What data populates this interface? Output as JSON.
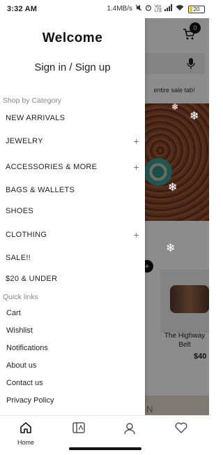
{
  "status_bar": {
    "time": "3:32 AM",
    "speed": "1.4MB/s",
    "net_label": "Vo) LTE",
    "battery": "20",
    "icons": [
      "mute-icon",
      "alarm-icon",
      "signal-icon",
      "wifi-icon",
      "battery-icon"
    ]
  },
  "background": {
    "cart_count": "0",
    "promo_text": "entire sale tab!",
    "product_name_partial": "a",
    "product_name": "The Highway Belt",
    "product_price": "$40",
    "button_partial": "N"
  },
  "drawer": {
    "welcome": "Welcome",
    "signin": "Sign in / Sign up",
    "category_heading": "Shop by Category",
    "categories": [
      {
        "label": "NEW ARRIVALS",
        "expandable": false
      },
      {
        "label": "JEWELRY",
        "expandable": true
      },
      {
        "label": "ACCESSORIES & MORE",
        "expandable": true
      },
      {
        "label": "BAGS & WALLETS",
        "expandable": false
      },
      {
        "label": "SHOES",
        "expandable": false
      },
      {
        "label": "CLOTHING",
        "expandable": true
      },
      {
        "label": "SALE!!",
        "expandable": false
      },
      {
        "label": "$20 & UNDER",
        "expandable": false
      }
    ],
    "expand_symbol": "+",
    "quick_links_heading": "Quick links",
    "quick_links": [
      "Cart",
      "Wishlist",
      "Notifications",
      "About us",
      "Contact us",
      "Privacy Policy"
    ]
  },
  "bottom_nav": {
    "home_label": "Home",
    "accent": "#111111"
  }
}
